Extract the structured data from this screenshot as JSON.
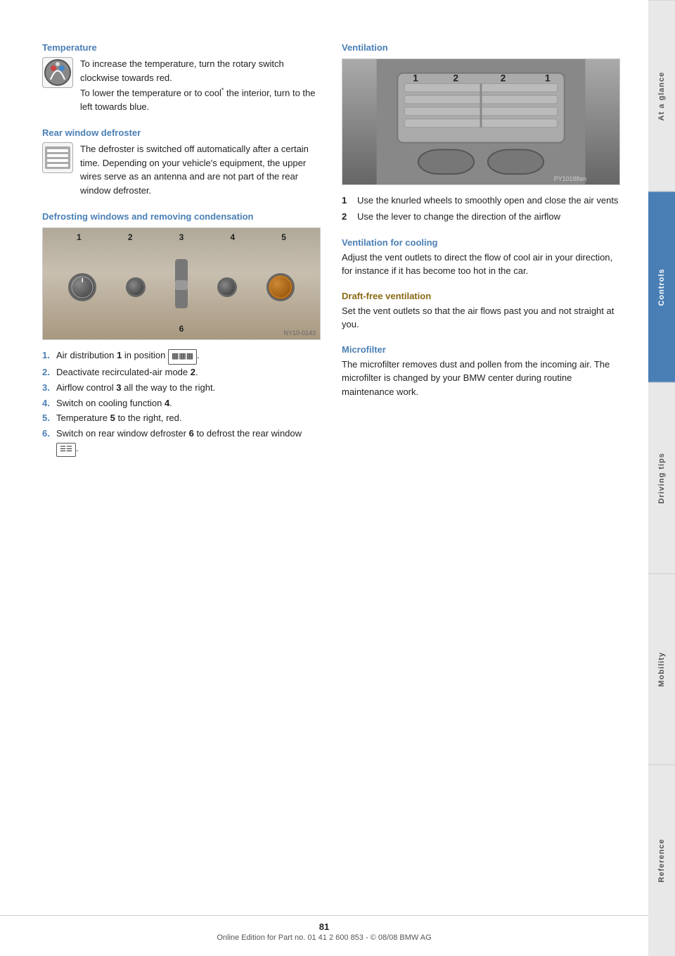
{
  "sidebar": {
    "tabs": [
      {
        "label": "At a glance",
        "active": false
      },
      {
        "label": "Controls",
        "active": true
      },
      {
        "label": "Driving tips",
        "active": false
      },
      {
        "label": "Mobility",
        "active": false
      },
      {
        "label": "Reference",
        "active": false
      }
    ]
  },
  "left_col": {
    "temperature": {
      "heading": "Temperature",
      "text1": "To increase the temperature, turn the rotary switch clockwise towards red.",
      "text2": "To lower the temperature or to cool",
      "superscript": "*",
      "text3": " the interior, turn to the left towards blue."
    },
    "rear_defroster": {
      "heading": "Rear window defroster",
      "text": "The defroster is switched off automatically after a certain time. Depending on your vehicle's equipment, the upper wires serve as an antenna and are not part of the rear window defroster."
    },
    "defrosting": {
      "heading": "Defrosting windows and removing condensation",
      "diagram_labels": [
        "1",
        "2",
        "3",
        "4",
        "5"
      ],
      "diagram_label_bottom": "6",
      "diagram_note": "NY10-0143",
      "steps": [
        {
          "num": "1.",
          "text": "Air distribution ",
          "bold": "1",
          "rest": " in position "
        },
        {
          "num": "2.",
          "text": "Deactivate recirculated-air mode ",
          "bold": "2",
          "rest": "."
        },
        {
          "num": "3.",
          "text": "Airflow control ",
          "bold": "3",
          "rest": " all the way to the right."
        },
        {
          "num": "4.",
          "text": "Switch on cooling function ",
          "bold": "4",
          "rest": "."
        },
        {
          "num": "5.",
          "text": "Temperature ",
          "bold": "5",
          "rest": " to the right, red."
        },
        {
          "num": "6.",
          "text": "Switch on rear window defroster ",
          "bold": "6",
          "rest": " to defrost the rear window "
        }
      ]
    }
  },
  "right_col": {
    "ventilation": {
      "heading": "Ventilation",
      "photo_note": "PY10188en",
      "vent_labels": [
        "1",
        "2",
        "2",
        "1"
      ],
      "items": [
        {
          "num": "1",
          "text": "Use the knurled wheels to smoothly open and close the air vents"
        },
        {
          "num": "2",
          "text": "Use the lever to change the direction of the airflow"
        }
      ]
    },
    "ventilation_cooling": {
      "heading": "Ventilation for cooling",
      "text": "Adjust the vent outlets to direct the flow of cool air in your direction, for instance if it has become too hot in the car."
    },
    "draft_free": {
      "heading": "Draft-free ventilation",
      "text": "Set the vent outlets so that the air flows past you and not straight at you."
    },
    "microfilter": {
      "heading": "Microfilter",
      "text": "The microfilter removes dust and pollen from the incoming air. The microfilter is changed by your BMW center during routine maintenance work."
    }
  },
  "footer": {
    "page_number": "81",
    "footer_text": "Online Edition for Part no. 01 41 2 600 853 - © 08/08 BMW AG"
  }
}
